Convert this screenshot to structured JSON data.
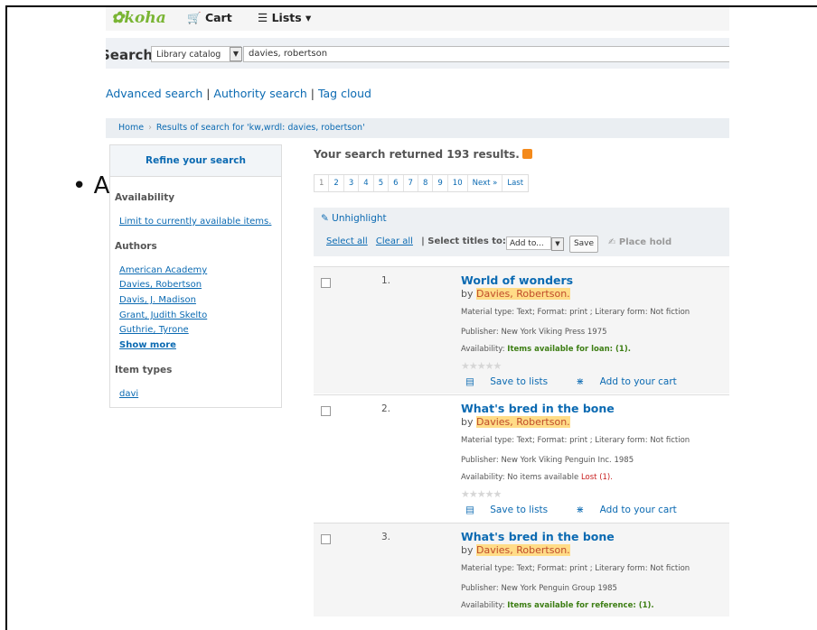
{
  "header": {
    "logo": "koha",
    "cart": "Cart",
    "lists": "Lists"
  },
  "search": {
    "label": "Search",
    "scope": "Library catalog",
    "query": "davies, robertson"
  },
  "links": {
    "advanced": "Advanced search",
    "authority": "Authority search",
    "tagcloud": "Tag cloud",
    "sep": " | "
  },
  "breadcrumb": {
    "home": "Home",
    "current": "Results of search for 'kw,wrdl: davies, robertson'"
  },
  "sidebar": {
    "title": "Refine your search",
    "availability_heading": "Availability",
    "limit_link": "Limit to currently available items.",
    "authors_heading": "Authors",
    "authors": [
      "American Academy",
      "Davies, Robertson",
      "Davis, J. Madison",
      "Grant, Judith Skelto",
      "Guthrie, Tyrone"
    ],
    "show_more": "Show more",
    "itemtypes_heading": "Item types",
    "itemtype": "davi"
  },
  "results": {
    "summary": "Your search returned 193 results.",
    "pages": [
      "1",
      "2",
      "3",
      "4",
      "5",
      "6",
      "7",
      "8",
      "9",
      "10",
      "Next »",
      "Last"
    ],
    "unhighlight": "Unhighlight",
    "select_all": "Select all",
    "clear_all": "Clear all",
    "select_titles": "| Select titles to:",
    "add_to": "Add to...",
    "save": "Save",
    "place_hold": "Place hold",
    "items": [
      {
        "number": "1.",
        "title": "World of wonders",
        "by": "by ",
        "author": "Davies, Robertson.",
        "material": "Material type:  Text; Format: print ; Literary form: Not fiction",
        "publisher": "Publisher: New York Viking Press 1975",
        "avail_prefix": "Availability: ",
        "avail_status": "Items available for loan: (1).",
        "avail_extra": ""
      },
      {
        "number": "2.",
        "title": "What's bred in the bone",
        "by": "by ",
        "author": "Davies, Robertson.",
        "material": "Material type:  Text; Format: print ; Literary form: Not fiction",
        "publisher": "Publisher: New York Viking Penguin Inc. 1985",
        "avail_prefix": "Availability: No items available ",
        "avail_status": "",
        "avail_extra": "Lost (1)."
      },
      {
        "number": "3.",
        "title": "What's bred in the bone",
        "by": "by ",
        "author": "Davies, Robertson.",
        "material": "Material type:  Text; Format: print ; Literary form: Not fiction",
        "publisher": "Publisher: New York Penguin Group 1985",
        "avail_prefix": "Availability: ",
        "avail_status": "Items available for reference: (1).",
        "avail_extra": ""
      }
    ],
    "save_to_lists": "Save to lists",
    "add_to_cart": "Add to your cart",
    "stars": "★★★★★"
  },
  "overlay": {
    "bullet": "• A"
  }
}
